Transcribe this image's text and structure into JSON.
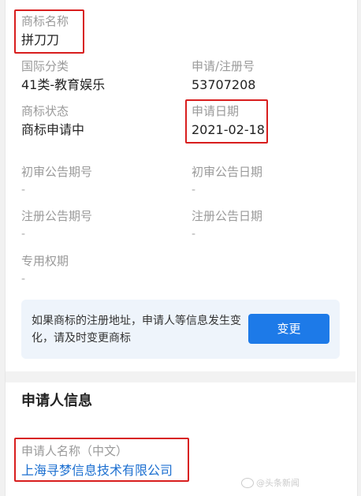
{
  "trademark": {
    "name_label": "商标名称",
    "name_value": "拼刀刀",
    "intl_class_label": "国际分类",
    "intl_class_value": "41类-教育娱乐",
    "reg_no_label": "申请/注册号",
    "reg_no_value": "53707208",
    "status_label": "商标状态",
    "status_value": "商标申请中",
    "apply_date_label": "申请日期",
    "apply_date_value": "2021-02-18",
    "prelim_no_label": "初审公告期号",
    "prelim_no_value": "-",
    "prelim_date_label": "初审公告日期",
    "prelim_date_value": "-",
    "reg_notice_no_label": "注册公告期号",
    "reg_notice_no_value": "-",
    "reg_notice_date_label": "注册公告日期",
    "reg_notice_date_value": "-",
    "exclusive_label": "专用权期",
    "exclusive_value": "-"
  },
  "notice": {
    "text": "如果商标的注册地址，申请人等信息发生变化，请及时变更商标",
    "button_label": "变更"
  },
  "applicant": {
    "section_title": "申请人信息",
    "name_label": "申请人名称（中文）",
    "name_value": "上海寻梦信息技术有限公司"
  },
  "watermark": {
    "text": "@头条新闻"
  },
  "colors": {
    "highlight_box": "#d81e1e",
    "button": "#1d7ae8",
    "link": "#1c6fd0",
    "notice_bg": "#eef4fb"
  }
}
